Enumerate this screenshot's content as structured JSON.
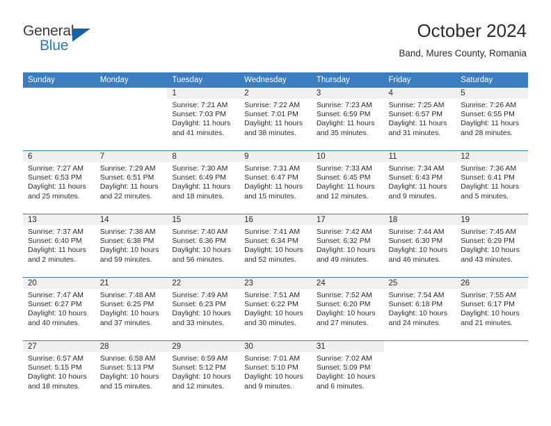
{
  "brand": {
    "name_part1": "General",
    "name_part2": "Blue",
    "logo_icon": "triangle-logo-icon",
    "accent_color": "#1f7ec4",
    "header_color": "#3b7dbf"
  },
  "header": {
    "month_title": "October 2024",
    "location": "Band, Mures County, Romania"
  },
  "weekday_headers": [
    "Sunday",
    "Monday",
    "Tuesday",
    "Wednesday",
    "Thursday",
    "Friday",
    "Saturday"
  ],
  "weeks": [
    [
      {
        "empty": true
      },
      {
        "empty": true
      },
      {
        "day": "1",
        "sunrise": "Sunrise: 7:21 AM",
        "sunset": "Sunset: 7:03 PM",
        "daylight_line1": "Daylight: 11 hours",
        "daylight_line2": "and 41 minutes."
      },
      {
        "day": "2",
        "sunrise": "Sunrise: 7:22 AM",
        "sunset": "Sunset: 7:01 PM",
        "daylight_line1": "Daylight: 11 hours",
        "daylight_line2": "and 38 minutes."
      },
      {
        "day": "3",
        "sunrise": "Sunrise: 7:23 AM",
        "sunset": "Sunset: 6:59 PM",
        "daylight_line1": "Daylight: 11 hours",
        "daylight_line2": "and 35 minutes."
      },
      {
        "day": "4",
        "sunrise": "Sunrise: 7:25 AM",
        "sunset": "Sunset: 6:57 PM",
        "daylight_line1": "Daylight: 11 hours",
        "daylight_line2": "and 31 minutes."
      },
      {
        "day": "5",
        "sunrise": "Sunrise: 7:26 AM",
        "sunset": "Sunset: 6:55 PM",
        "daylight_line1": "Daylight: 11 hours",
        "daylight_line2": "and 28 minutes."
      }
    ],
    [
      {
        "day": "6",
        "sunrise": "Sunrise: 7:27 AM",
        "sunset": "Sunset: 6:53 PM",
        "daylight_line1": "Daylight: 11 hours",
        "daylight_line2": "and 25 minutes."
      },
      {
        "day": "7",
        "sunrise": "Sunrise: 7:29 AM",
        "sunset": "Sunset: 6:51 PM",
        "daylight_line1": "Daylight: 11 hours",
        "daylight_line2": "and 22 minutes."
      },
      {
        "day": "8",
        "sunrise": "Sunrise: 7:30 AM",
        "sunset": "Sunset: 6:49 PM",
        "daylight_line1": "Daylight: 11 hours",
        "daylight_line2": "and 18 minutes."
      },
      {
        "day": "9",
        "sunrise": "Sunrise: 7:31 AM",
        "sunset": "Sunset: 6:47 PM",
        "daylight_line1": "Daylight: 11 hours",
        "daylight_line2": "and 15 minutes."
      },
      {
        "day": "10",
        "sunrise": "Sunrise: 7:33 AM",
        "sunset": "Sunset: 6:45 PM",
        "daylight_line1": "Daylight: 11 hours",
        "daylight_line2": "and 12 minutes."
      },
      {
        "day": "11",
        "sunrise": "Sunrise: 7:34 AM",
        "sunset": "Sunset: 6:43 PM",
        "daylight_line1": "Daylight: 11 hours",
        "daylight_line2": "and 9 minutes."
      },
      {
        "day": "12",
        "sunrise": "Sunrise: 7:36 AM",
        "sunset": "Sunset: 6:41 PM",
        "daylight_line1": "Daylight: 11 hours",
        "daylight_line2": "and 5 minutes."
      }
    ],
    [
      {
        "day": "13",
        "sunrise": "Sunrise: 7:37 AM",
        "sunset": "Sunset: 6:40 PM",
        "daylight_line1": "Daylight: 11 hours",
        "daylight_line2": "and 2 minutes."
      },
      {
        "day": "14",
        "sunrise": "Sunrise: 7:38 AM",
        "sunset": "Sunset: 6:38 PM",
        "daylight_line1": "Daylight: 10 hours",
        "daylight_line2": "and 59 minutes."
      },
      {
        "day": "15",
        "sunrise": "Sunrise: 7:40 AM",
        "sunset": "Sunset: 6:36 PM",
        "daylight_line1": "Daylight: 10 hours",
        "daylight_line2": "and 56 minutes."
      },
      {
        "day": "16",
        "sunrise": "Sunrise: 7:41 AM",
        "sunset": "Sunset: 6:34 PM",
        "daylight_line1": "Daylight: 10 hours",
        "daylight_line2": "and 52 minutes."
      },
      {
        "day": "17",
        "sunrise": "Sunrise: 7:42 AM",
        "sunset": "Sunset: 6:32 PM",
        "daylight_line1": "Daylight: 10 hours",
        "daylight_line2": "and 49 minutes."
      },
      {
        "day": "18",
        "sunrise": "Sunrise: 7:44 AM",
        "sunset": "Sunset: 6:30 PM",
        "daylight_line1": "Daylight: 10 hours",
        "daylight_line2": "and 46 minutes."
      },
      {
        "day": "19",
        "sunrise": "Sunrise: 7:45 AM",
        "sunset": "Sunset: 6:29 PM",
        "daylight_line1": "Daylight: 10 hours",
        "daylight_line2": "and 43 minutes."
      }
    ],
    [
      {
        "day": "20",
        "sunrise": "Sunrise: 7:47 AM",
        "sunset": "Sunset: 6:27 PM",
        "daylight_line1": "Daylight: 10 hours",
        "daylight_line2": "and 40 minutes."
      },
      {
        "day": "21",
        "sunrise": "Sunrise: 7:48 AM",
        "sunset": "Sunset: 6:25 PM",
        "daylight_line1": "Daylight: 10 hours",
        "daylight_line2": "and 37 minutes."
      },
      {
        "day": "22",
        "sunrise": "Sunrise: 7:49 AM",
        "sunset": "Sunset: 6:23 PM",
        "daylight_line1": "Daylight: 10 hours",
        "daylight_line2": "and 33 minutes."
      },
      {
        "day": "23",
        "sunrise": "Sunrise: 7:51 AM",
        "sunset": "Sunset: 6:22 PM",
        "daylight_line1": "Daylight: 10 hours",
        "daylight_line2": "and 30 minutes."
      },
      {
        "day": "24",
        "sunrise": "Sunrise: 7:52 AM",
        "sunset": "Sunset: 6:20 PM",
        "daylight_line1": "Daylight: 10 hours",
        "daylight_line2": "and 27 minutes."
      },
      {
        "day": "25",
        "sunrise": "Sunrise: 7:54 AM",
        "sunset": "Sunset: 6:18 PM",
        "daylight_line1": "Daylight: 10 hours",
        "daylight_line2": "and 24 minutes."
      },
      {
        "day": "26",
        "sunrise": "Sunrise: 7:55 AM",
        "sunset": "Sunset: 6:17 PM",
        "daylight_line1": "Daylight: 10 hours",
        "daylight_line2": "and 21 minutes."
      }
    ],
    [
      {
        "day": "27",
        "sunrise": "Sunrise: 6:57 AM",
        "sunset": "Sunset: 5:15 PM",
        "daylight_line1": "Daylight: 10 hours",
        "daylight_line2": "and 18 minutes."
      },
      {
        "day": "28",
        "sunrise": "Sunrise: 6:58 AM",
        "sunset": "Sunset: 5:13 PM",
        "daylight_line1": "Daylight: 10 hours",
        "daylight_line2": "and 15 minutes."
      },
      {
        "day": "29",
        "sunrise": "Sunrise: 6:59 AM",
        "sunset": "Sunset: 5:12 PM",
        "daylight_line1": "Daylight: 10 hours",
        "daylight_line2": "and 12 minutes."
      },
      {
        "day": "30",
        "sunrise": "Sunrise: 7:01 AM",
        "sunset": "Sunset: 5:10 PM",
        "daylight_line1": "Daylight: 10 hours",
        "daylight_line2": "and 9 minutes."
      },
      {
        "day": "31",
        "sunrise": "Sunrise: 7:02 AM",
        "sunset": "Sunset: 5:09 PM",
        "daylight_line1": "Daylight: 10 hours",
        "daylight_line2": "and 6 minutes."
      },
      {
        "empty": true
      },
      {
        "empty": true
      }
    ]
  ]
}
